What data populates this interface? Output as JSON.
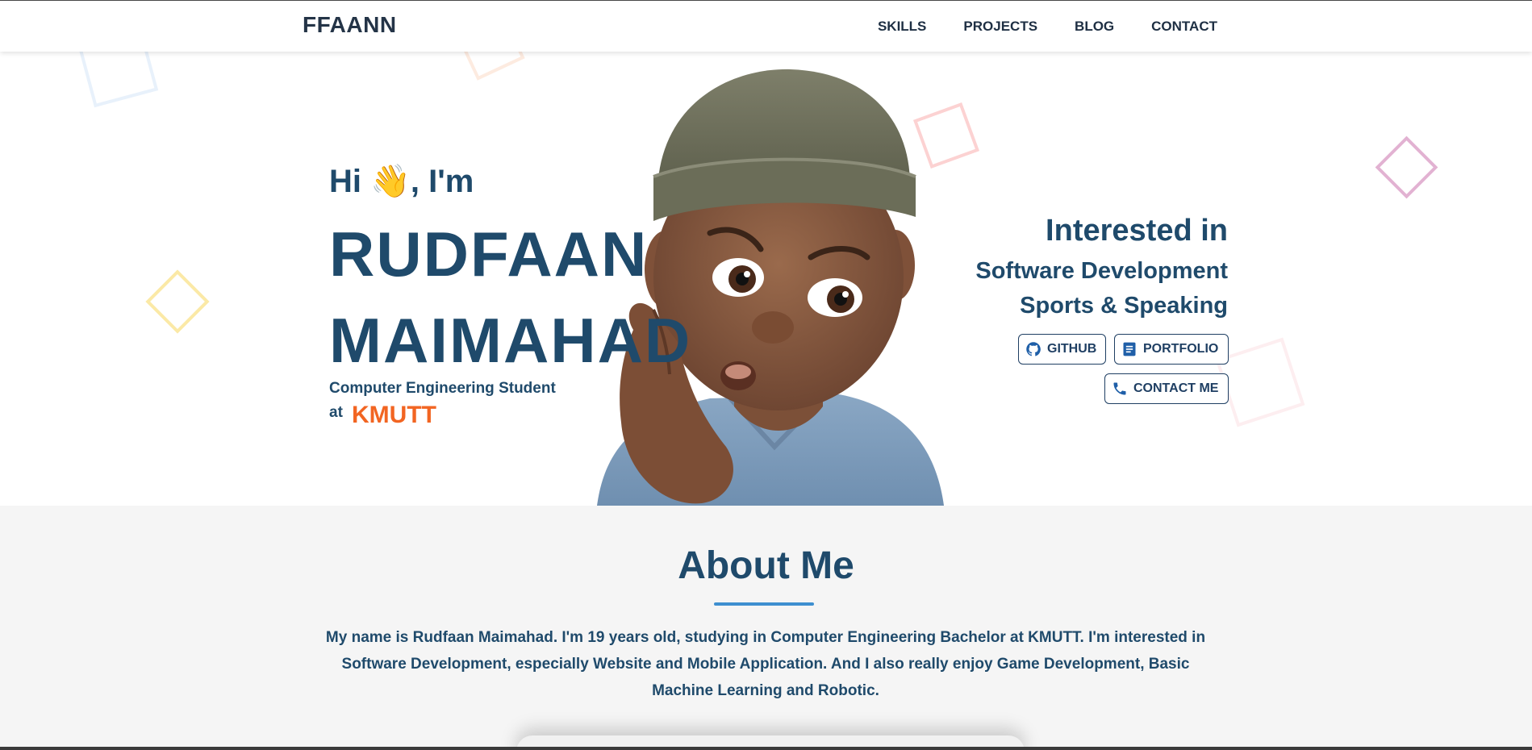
{
  "nav": {
    "brand": "FFAANN",
    "links": [
      "SKILLS",
      "PROJECTS",
      "BLOG",
      "CONTACT"
    ]
  },
  "hero": {
    "greeting": "Hi 👋, I'm",
    "first_name": "RUDFAAN",
    "last_name": "MAIMAHAD",
    "role": "Computer Engineering Student",
    "at_label": "at",
    "school": "KMUTT",
    "interest_title": "Interested in",
    "interests": [
      "Software Development",
      "Sports & Speaking"
    ],
    "buttons": {
      "github": "GITHUB",
      "portfolio": "PORTFOLIO",
      "contact": "CONTACT ME"
    }
  },
  "about": {
    "title": "About Me",
    "text": "My name is Rudfaan Maimahad. I'm 19 years old, studying in Computer Engineering Bachelor at KMUTT. I'm interested in Software Development, especially Website and Mobile Application. And I also really enjoy Game Development, Basic Machine Learning and Robotic."
  },
  "icons": {
    "github": "github-icon",
    "portfolio": "document-icon",
    "contact": "phone-icon",
    "avatar": "memoji-avatar"
  },
  "colors": {
    "primary_text": "#1f4a6b",
    "accent_orange": "#f26522",
    "underline_blue": "#3e8fd0",
    "about_bg": "#f5f5f5"
  }
}
